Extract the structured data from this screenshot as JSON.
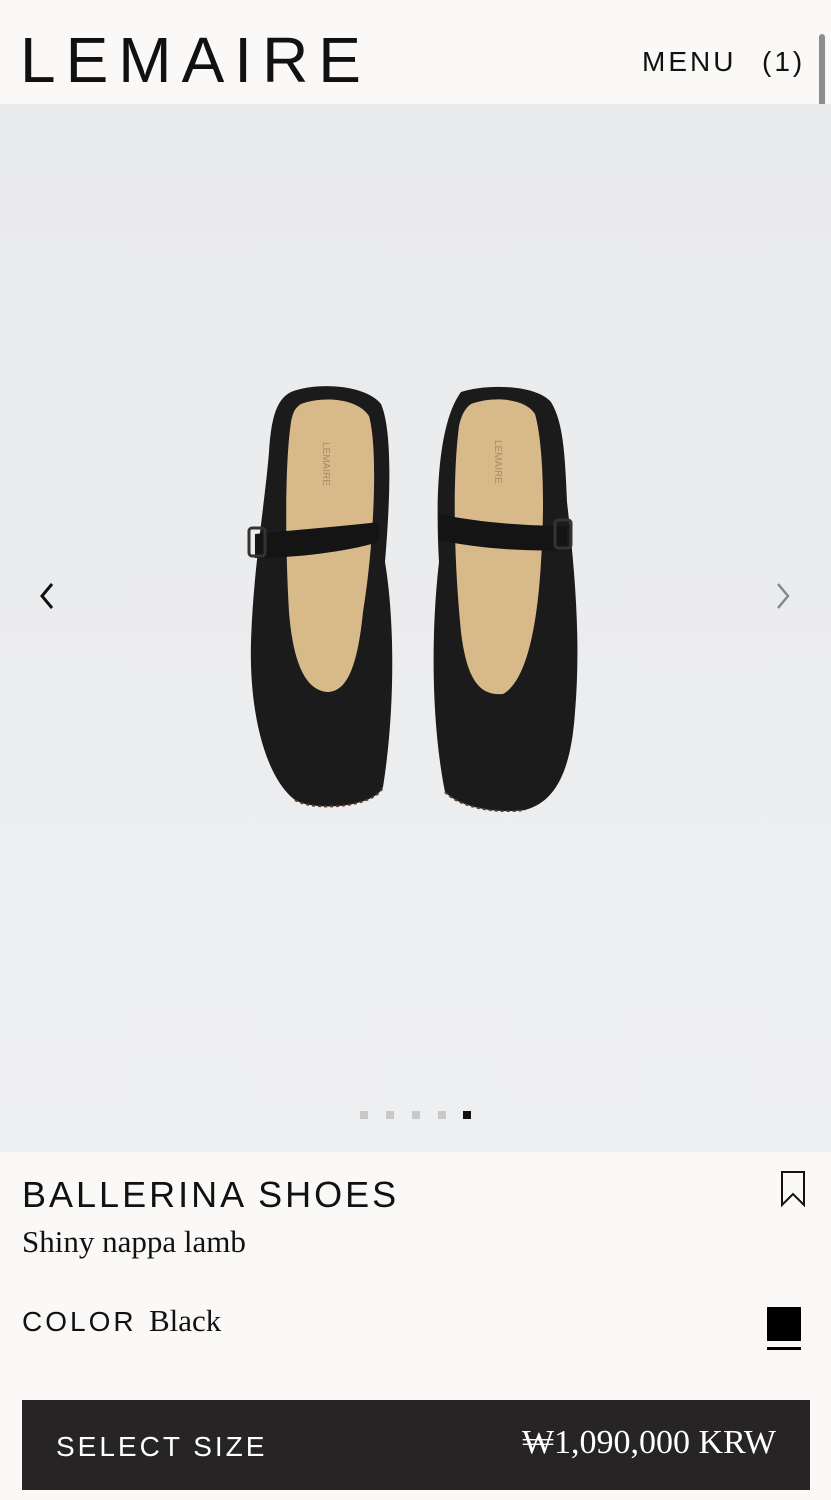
{
  "header": {
    "logo": "LEMAIRE",
    "menu_label": "MENU",
    "cart_label": "(1)"
  },
  "gallery": {
    "image_count": 5,
    "active_index": 4,
    "shoe_insole_text": "LEMAIRE",
    "icons": {
      "prev": "chevron-left-icon",
      "next": "chevron-right-icon"
    }
  },
  "product": {
    "name": "BALLERINA SHOES",
    "material": "Shiny nappa lamb",
    "color_label": "COLOR",
    "color_value": "Black",
    "swatch_color": "#000000"
  },
  "buy": {
    "size_label": "SELECT SIZE",
    "price": "₩1,090,000 KRW",
    "background": "#272425"
  }
}
